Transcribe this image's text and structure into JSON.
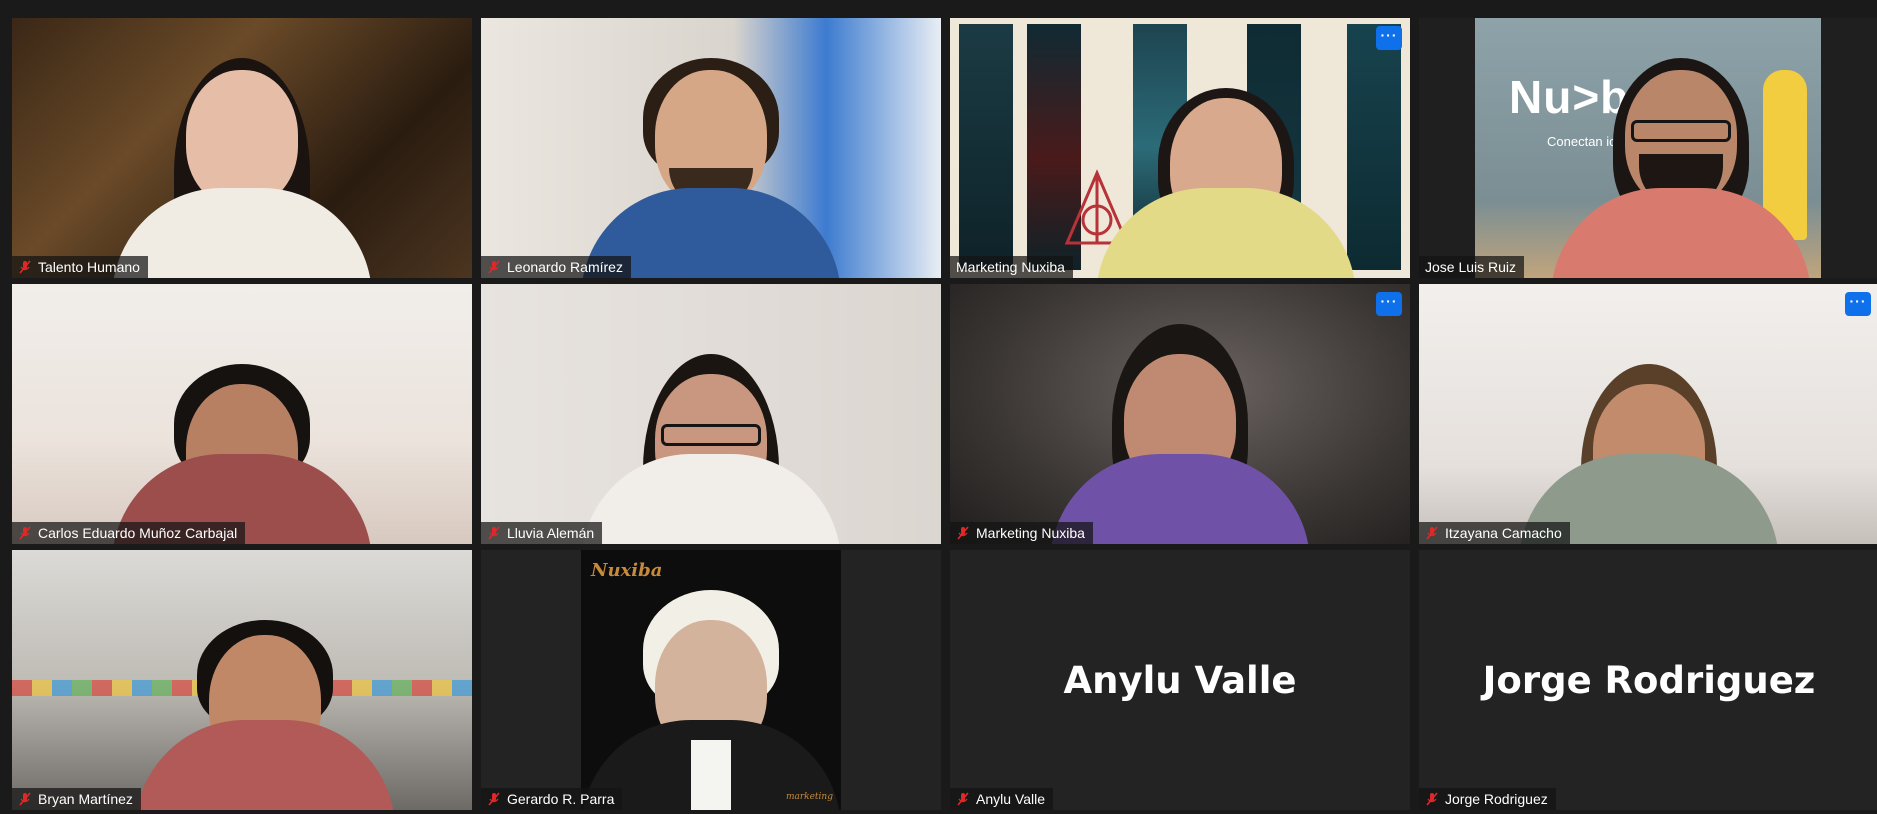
{
  "participants": [
    {
      "name": "Talento Humano",
      "muted": true
    },
    {
      "name": "Leonardo Ramírez",
      "muted": true
    },
    {
      "name": "Marketing Nuxiba",
      "muted": false,
      "active_speaker": true,
      "more_label": "···"
    },
    {
      "name": "Jose Luis Ruiz",
      "muted": false
    },
    {
      "name": "Carlos Eduardo Muñoz Carbajal",
      "muted": true
    },
    {
      "name": "Lluvia Alemán",
      "muted": true
    },
    {
      "name": "Marketing Nuxiba",
      "muted": true,
      "more_label": "···"
    },
    {
      "name": "Itzayana Camacho",
      "muted": true,
      "more_label": "···"
    },
    {
      "name": "Bryan Martínez",
      "muted": true
    },
    {
      "name": "Gerardo R. Parra",
      "muted": true
    },
    {
      "name": "Anylu Valle",
      "muted": true,
      "video_off": true,
      "display_name": "Anylu Valle"
    },
    {
      "name": "Jorge Rodriguez",
      "muted": true,
      "video_off": true,
      "display_name": "Jorge Rodriguez"
    }
  ],
  "backgrounds": {
    "jose_sign_logo": "Nu>ba",
    "jose_sign_sub": "Conectan             icio",
    "gerardo_poster_brand": "Nuxiba",
    "gerardo_poster_tag": "marketing"
  },
  "colors": {
    "active_speaker_border": "#c6e64a",
    "more_button": "#0e71eb",
    "muted_mic": "#e02828"
  },
  "icons": {
    "muted": "mic-muted-icon",
    "more": "more-options-icon"
  }
}
